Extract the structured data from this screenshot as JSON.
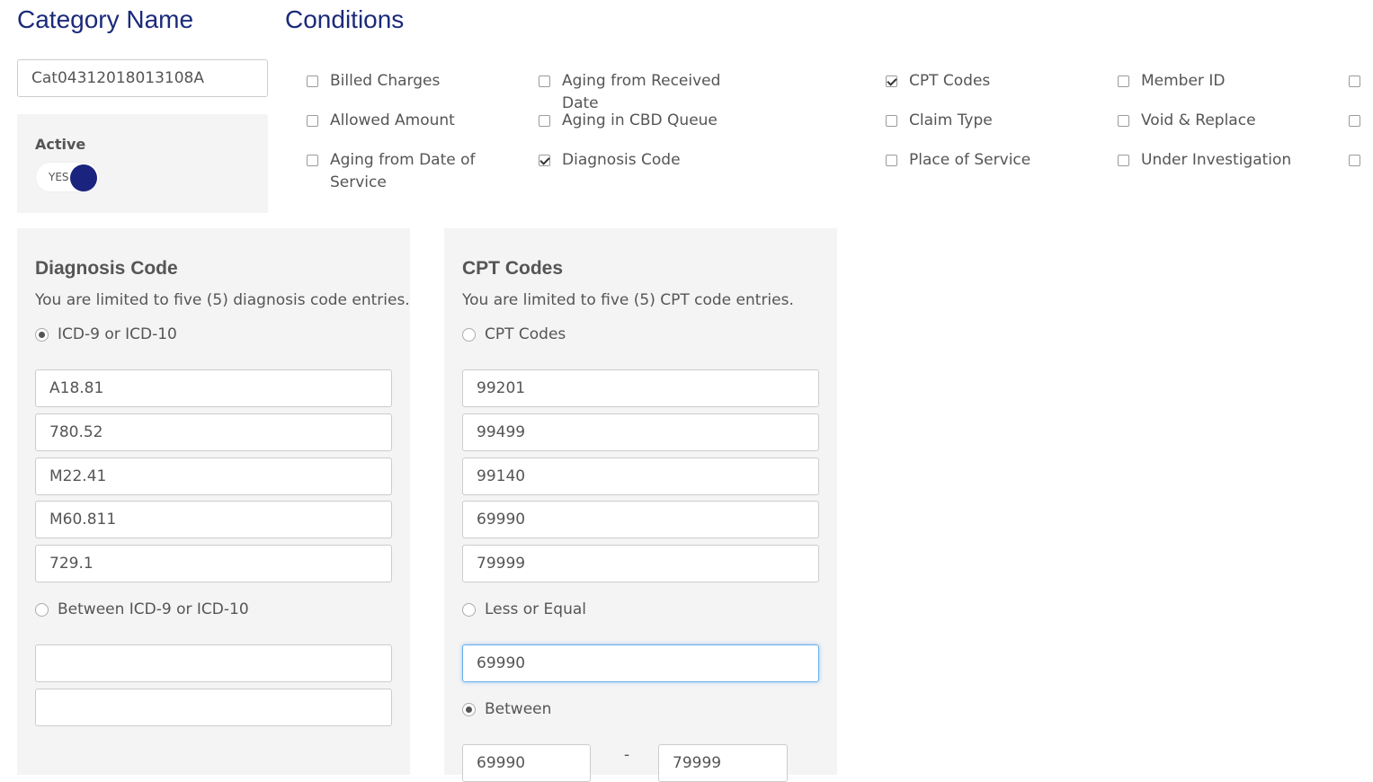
{
  "category": {
    "heading": "Category Name",
    "name_value": "Cat04312018013108A",
    "active_label": "Active",
    "toggle_text": "YES"
  },
  "conditions": {
    "heading": "Conditions",
    "items": [
      {
        "label": "Billed Charges",
        "checked": false
      },
      {
        "label": "Aging from Received Date",
        "checked": false
      },
      {
        "label": "CPT Codes",
        "checked": true
      },
      {
        "label": "Member ID",
        "checked": false
      },
      {
        "label": "",
        "checked": false
      },
      {
        "label": "Allowed Amount",
        "checked": false
      },
      {
        "label": "Aging in CBD Queue",
        "checked": false
      },
      {
        "label": "Claim Type",
        "checked": false
      },
      {
        "label": "Void & Replace",
        "checked": false
      },
      {
        "label": "",
        "checked": false
      },
      {
        "label": "Aging from Date of Service",
        "checked": false
      },
      {
        "label": "Diagnosis Code",
        "checked": true
      },
      {
        "label": "Place of Service",
        "checked": false
      },
      {
        "label": "Under Investigation",
        "checked": false
      },
      {
        "label": "",
        "checked": false
      }
    ]
  },
  "diagnosis": {
    "title": "Diagnosis Code",
    "note": "You are limited to five (5) diagnosis code entries.",
    "option_single": "ICD-9 or ICD-10",
    "codes": [
      "A18.81",
      "780.52",
      "M22.41",
      "M60.811",
      "729.1"
    ],
    "option_between": "Between ICD-9 or ICD-10",
    "between_from": "",
    "between_to": ""
  },
  "cpt": {
    "title": "CPT Codes",
    "note": "You are limited to five (5) CPT code entries.",
    "option_codes": "CPT Codes",
    "codes": [
      "99201",
      "99499",
      "99140",
      "69990",
      "79999"
    ],
    "option_less_equal": "Less or Equal",
    "less_equal_value": "69990",
    "option_between": "Between",
    "between_separator": "-",
    "between_from": "69990",
    "between_to": "79999"
  },
  "colors": {
    "heading": "#1b2a7a",
    "toggle_knob": "#1a237e",
    "panel_bg": "#f4f4f4",
    "focus_border": "#66afe9"
  }
}
